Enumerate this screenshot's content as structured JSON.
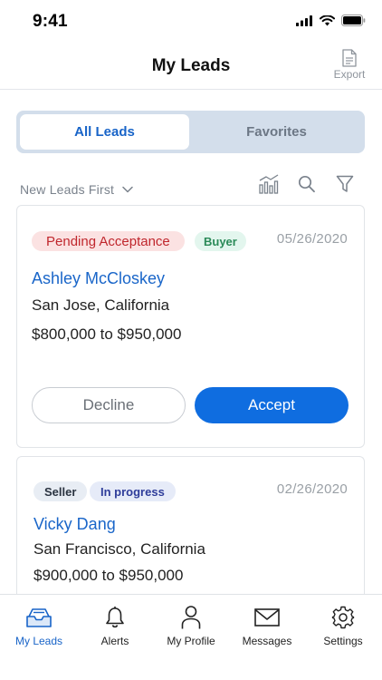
{
  "status_bar": {
    "time": "9:41"
  },
  "header": {
    "title": "My Leads",
    "export_label": "Export"
  },
  "segmented": {
    "all_label": "All Leads",
    "favorites_label": "Favorites"
  },
  "toolbar": {
    "sort_label": "New Leads First"
  },
  "leads": [
    {
      "status": "Pending Acceptance",
      "type": "Buyer",
      "date": "05/26/2020",
      "name": "Ashley McCloskey",
      "location": "San Jose, California",
      "price": "$800,000 to $950,000",
      "decline_label": "Decline",
      "accept_label": "Accept"
    },
    {
      "type": "Seller",
      "status": "In progress",
      "date": "02/26/2020",
      "name": "Vicky Dang",
      "location": "San Francisco, California",
      "price": "$900,000 to $950,000"
    }
  ],
  "tabbar": {
    "items": [
      {
        "label": "My Leads",
        "icon": "inbox-icon"
      },
      {
        "label": "Alerts",
        "icon": "bell-icon"
      },
      {
        "label": "My Profile",
        "icon": "person-icon"
      },
      {
        "label": "Messages",
        "icon": "envelope-icon"
      },
      {
        "label": "Settings",
        "icon": "gear-icon"
      }
    ]
  },
  "colors": {
    "accent": "#1864c8",
    "accept_button": "#0f6de0",
    "pending_bg": "#fbe2e2",
    "pending_text": "#c0272d",
    "buyer_bg": "#e3f6ee",
    "buyer_text": "#2a8a58"
  }
}
